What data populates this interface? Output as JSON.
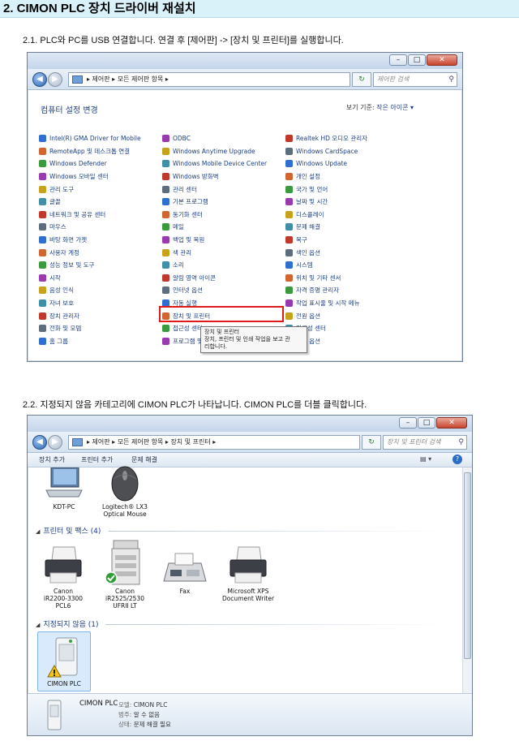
{
  "header": {
    "title": "2. CIMON PLC 장치 드라이버 재설치"
  },
  "step1": {
    "text": "2.1. PLC와 PC를 USB 연결합니다. 연결 후 [제어판] -> [장치 및 프린터]를 실행합니다."
  },
  "step2": {
    "text": "2.2. 지정되지 않음 카테고리에 CIMON PLC가 나타납니다. CIMON PLC를 더블 클릭합니다."
  },
  "win1": {
    "address": "▸ 제어판 ▸ 모든 제어판 항목 ▸",
    "search_placeholder": "제어판 검색",
    "title": "컴퓨터 설정 변경",
    "view_label": "보기 기준:",
    "view_value": "작은 아이콘 ▾",
    "col1": [
      "Intel(R) GMA Driver for Mobile",
      "RemoteApp 및 데스크톱 연결",
      "Windows Defender",
      "Windows 모바일 센터",
      "관리 도구",
      "글꼴",
      "네트워크 및 공유 센터",
      "마우스",
      "바탕 화면 가젯",
      "사용자 계정",
      "성능 정보 및 도구",
      "시작",
      "음성 인식",
      "자녀 보호",
      "장치 관리자",
      "전화 및 모뎀",
      "홈 그룹"
    ],
    "col2": [
      "ODBC",
      "Windows Anytime Upgrade",
      "Windows Mobile Device Center",
      "Windows 방화벽",
      "관리 센터",
      "기본 프로그램",
      "동기화 센터",
      "메일",
      "백업 및 복원",
      "색 관리",
      "소리",
      "알림 영역 아이콘",
      "인터넷 옵션",
      "자동 실행",
      "장치 및 프린터",
      "접근성 센터",
      "프로그램 및 기능"
    ],
    "col3": [
      "Realtek HD 오디오 관리자",
      "Windows CardSpace",
      "Windows Update",
      "개인 설정",
      "국가 및 언어",
      "날짜 및 시간",
      "디스플레이",
      "문제 해결",
      "복구",
      "색인 옵션",
      "시스템",
      "위치 및 기타 센서",
      "자격 증명 관리자",
      "작업 표시줄 및 시작 메뉴",
      "전원 옵션",
      "접근성 센터",
      "색인 옵션"
    ],
    "tooltip": {
      "line1": "장치 및 프린터",
      "line2": "장치, 프린터 및 인쇄 작업을 보고 관",
      "line3": "리합니다."
    }
  },
  "win2": {
    "address": "▸ 제어판 ▸ 모든 제어판 항목 ▸ 장치 및 프린터 ▸",
    "search_placeholder": "장치 및 프린터 검색",
    "toolbar": {
      "add_device": "장치 추가",
      "add_printer": "프린터 추가",
      "troubleshoot": "문제 해결"
    },
    "devices": [
      {
        "label1": "KDT-PC",
        "label2": ""
      },
      {
        "label1": "Logitech® LX3",
        "label2": "Optical Mouse"
      }
    ],
    "printers_group": "프린터 및 팩스 (4)",
    "printers": [
      {
        "label1": "Canon",
        "label2": "iR2200-3300",
        "label3": "PCL6"
      },
      {
        "label1": "Canon",
        "label2": "iR2525/2530",
        "label3": "UFRII LT"
      },
      {
        "label1": "Fax",
        "label2": "",
        "label3": ""
      },
      {
        "label1": "Microsoft XPS",
        "label2": "Document Writer",
        "label3": ""
      }
    ],
    "unspecified_group": "지정되지 않음 (1)",
    "unspecified_device": "CIMON PLC",
    "details": {
      "name": "CIMON PLC",
      "model_k": "모델:",
      "model_v": "CIMON PLC",
      "cat_k": "범주:",
      "cat_v": "알 수 없음",
      "status_k": "상태:",
      "status_v": "문제 해결 필요"
    }
  },
  "colors": {
    "header_bg": "#d9f1f8",
    "highlight": "#e0191b",
    "link": "#1c3f86"
  }
}
